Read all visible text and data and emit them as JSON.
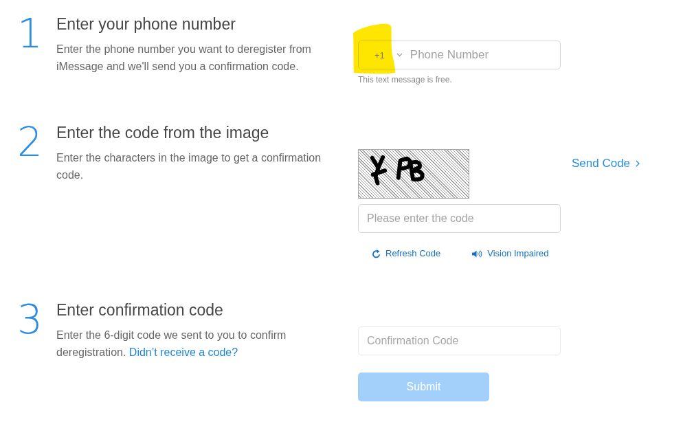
{
  "steps": [
    {
      "kind": "phone",
      "number": "1",
      "title": "Enter your phone number",
      "description": "Enter the phone number you want to deregister from iMessage and we'll send you a confirmation code.",
      "phone_field": {
        "country_code": "+1",
        "highlighted": true,
        "placeholder": "Phone Number"
      },
      "hint": "This text message is free."
    },
    {
      "kind": "captcha",
      "number": "2",
      "title": "Enter the code from the image",
      "description": "Enter the characters in the image to get a confirmation code.",
      "code_field": {
        "placeholder": "Please enter the code"
      },
      "links": [
        {
          "kind": "refresh",
          "label": "Refresh Code"
        },
        {
          "kind": "audio",
          "label": "Vision Impaired"
        }
      ],
      "send_code": "Send Code"
    },
    {
      "kind": "confirm",
      "number": "3",
      "title": "Enter confirmation code",
      "description": "Enter the 6-digit code we sent to you to confirm deregistration.",
      "help_link": "Didn’t receive a code?",
      "code_field": {
        "placeholder": "Confirmation Code",
        "disabled": true
      },
      "submit": {
        "label": "Submit",
        "disabled": true
      }
    }
  ]
}
